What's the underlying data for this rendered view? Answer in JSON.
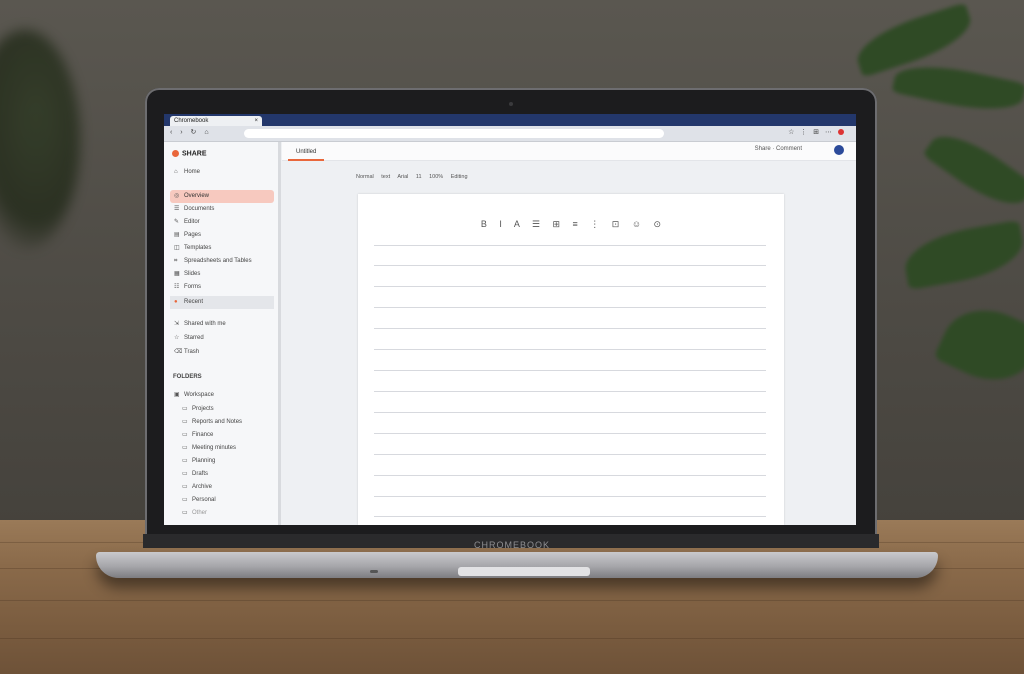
{
  "tab": {
    "title": "Chromebook",
    "close": "×"
  },
  "browser": {
    "url": "",
    "nav": "‹ › ↻ ⌂",
    "tools": "☆ ⋮ ⊞ ⋯"
  },
  "laptop": {
    "brand": "CHROMEBOOK"
  },
  "sidebar": {
    "brand": "SHARE",
    "items": [
      {
        "icon": "⌂",
        "label": "Home"
      },
      {
        "icon": "◎",
        "label": "Overview"
      },
      {
        "icon": "☰",
        "label": "Documents"
      },
      {
        "icon": "✎",
        "label": "Editor"
      },
      {
        "icon": "▤",
        "label": "Pages"
      },
      {
        "icon": "◫",
        "label": "Templates"
      },
      {
        "icon": "⌗",
        "label": "Spreadsheets and Tables"
      },
      {
        "icon": "▦",
        "label": "Slides"
      },
      {
        "icon": "☷",
        "label": "Forms"
      },
      {
        "icon": "●",
        "label": "Recent"
      },
      {
        "icon": "⇲",
        "label": "Shared with me"
      },
      {
        "icon": "☆",
        "label": "Starred"
      },
      {
        "icon": "⌫",
        "label": "Trash"
      }
    ],
    "section": "FOLDERS",
    "folders": [
      {
        "icon": "▣",
        "label": "Workspace"
      },
      {
        "icon": "▭",
        "label": "Projects"
      },
      {
        "icon": "▭",
        "label": "Reports and Notes"
      },
      {
        "icon": "▭",
        "label": "Finance"
      },
      {
        "icon": "▭",
        "label": "Meeting minutes"
      },
      {
        "icon": "▭",
        "label": "Planning"
      },
      {
        "icon": "▭",
        "label": "Drafts"
      },
      {
        "icon": "▭",
        "label": "Archive"
      },
      {
        "icon": "▭",
        "label": "Personal"
      },
      {
        "icon": "▭",
        "label": "Other"
      }
    ]
  },
  "main": {
    "tab_label": "Untitled",
    "header_right": "Share · Comment",
    "filters": "Normal text Arial 11 100% Editing",
    "format_bar": "B I A ☰ ⊞ ≡ ⋮ ⊡ ☺ ⊙"
  },
  "colors": {
    "accent": "#e9673b",
    "browser_bar": "#23376b",
    "active_item": "#f7c9bf"
  }
}
